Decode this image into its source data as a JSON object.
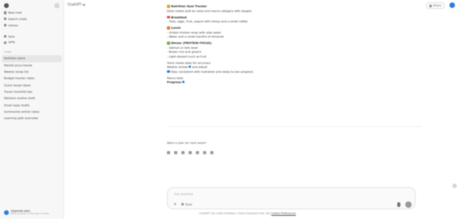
{
  "sidebar": {
    "top_items": [
      {
        "label": "New chat",
        "icon": "pencil-icon"
      },
      {
        "label": "Search chats",
        "icon": "search-icon"
      },
      {
        "label": "Library",
        "icon": "library-icon"
      }
    ],
    "mid_items": [
      {
        "label": "Sora",
        "icon": "sora-icon"
      },
      {
        "label": "GPTs",
        "icon": "gpts-icon"
      }
    ],
    "section_label": "Chats",
    "chats": [
      {
        "label": "Nutrition plans",
        "active": true
      },
      {
        "label": "Market price trends",
        "active": false
      },
      {
        "label": "Weekly recap list",
        "active": false
      },
      {
        "label": "Budget tracker notes",
        "active": false
      },
      {
        "label": "Quick recipe ideas",
        "active": false
      },
      {
        "label": "Travel checklist tips",
        "active": false
      },
      {
        "label": "Workout routine draft",
        "active": false
      },
      {
        "label": "Email reply drafts",
        "active": false
      },
      {
        "label": "Summarize article notes",
        "active": false
      },
      {
        "label": "Learning path overview",
        "active": false
      }
    ],
    "footer": {
      "name": "Upgrade plan",
      "sub": "More access to the best models"
    }
  },
  "header": {
    "model": "ChatGPT",
    "share_label": "Share"
  },
  "message": {
    "lines": [
      {
        "text": "Nutrition Goal Tracker",
        "head": true,
        "emoji": "#e0a030"
      },
      {
        "text": "Daily intake split by meal and macro category with targets",
        "head": false
      },
      {
        "gap": true
      },
      {
        "text": "Breakfast",
        "head": true,
        "emoji": "#d9534f"
      },
      {
        "text": "- Oats, eggs, fruit, yogurt with honey and a small coffee",
        "head": false
      },
      {
        "gap": true
      },
      {
        "text": "Lunch",
        "head": true,
        "emoji": "#e07b2f"
      },
      {
        "text": "- Grilled chicken wrap with side salad",
        "head": false
      },
      {
        "text": "- Water and a small handful of almonds",
        "head": false
      },
      {
        "gap": true
      },
      {
        "text": "Dinner (PROTEIN FOCUS)",
        "head": true,
        "emoji": "#7cae3f"
      },
      {
        "text": "- Salmon or tofu bowl",
        "head": false
      },
      {
        "text": "- Brown rice and greens",
        "head": false
      },
      {
        "text": "- Light dessert such as fruit",
        "head": false
      },
      {
        "gap": true
      },
      {
        "text": "Track meals daily for accuracy",
        "head": false
      },
      {
        "text": "Weekly review",
        "head": false,
        "pill": true,
        "after": "and adjust"
      },
      {
        "text": "Stay consistent with hydration and sleep to see progress",
        "head": false,
        "emoji": "#2f7de1"
      },
      {
        "gap": true
      },
      {
        "text": "Macro total",
        "head": false
      },
      {
        "text": "Progress",
        "head": true,
        "pill": true
      }
    ]
  },
  "followup": "Want a plan for next week?",
  "composer": {
    "placeholder": "Ask anything",
    "tool_label": "Tools"
  },
  "disclaimer": {
    "text": "ChatGPT can make mistakes. Check important info. See",
    "link": "Cookie Preferences"
  },
  "help": "?"
}
